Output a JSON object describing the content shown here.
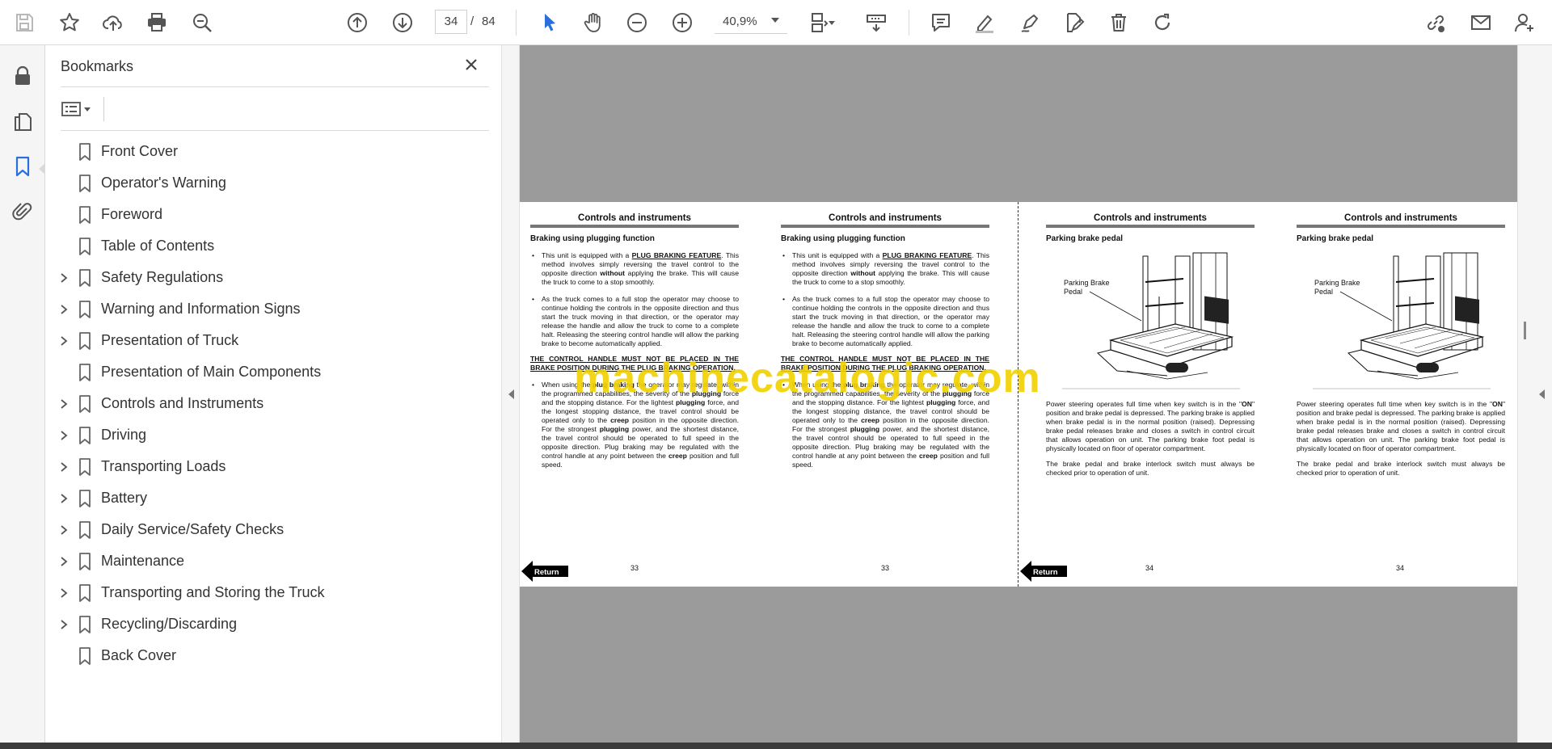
{
  "toolbar": {
    "current_page": "34",
    "page_separator": "/",
    "total_pages": "84",
    "zoom": "40,9%"
  },
  "bookmarks": {
    "title": "Bookmarks",
    "items": [
      {
        "label": "Front Cover",
        "expandable": false
      },
      {
        "label": "Operator's Warning",
        "expandable": false
      },
      {
        "label": "Foreword",
        "expandable": false
      },
      {
        "label": "Table of Contents",
        "expandable": false
      },
      {
        "label": "Safety Regulations",
        "expandable": true
      },
      {
        "label": "Warning and Information Signs",
        "expandable": true
      },
      {
        "label": "Presentation of Truck",
        "expandable": true
      },
      {
        "label": "Presentation of Main Components",
        "expandable": false
      },
      {
        "label": "Controls and Instruments",
        "expandable": true
      },
      {
        "label": "Driving",
        "expandable": true
      },
      {
        "label": "Transporting Loads",
        "expandable": true
      },
      {
        "label": "Battery",
        "expandable": true
      },
      {
        "label": "Daily Service/Safety Checks",
        "expandable": true
      },
      {
        "label": "Maintenance",
        "expandable": true
      },
      {
        "label": "Transporting and Storing the Truck",
        "expandable": true
      },
      {
        "label": "Recycling/Discarding",
        "expandable": true
      },
      {
        "label": "Back Cover",
        "expandable": false
      }
    ]
  },
  "document": {
    "heading": "Controls and instruments",
    "left": {
      "subheading": "Braking using plugging function",
      "b1_a": "This unit is equipped with a ",
      "b1_strong": "PLUG BRAKING FEATURE",
      "b1_b": ". This method involves simply reversing the travel control to the opposite direction ",
      "b1_strong2": "without",
      "b1_c": " applying the brake. This will cause the truck to come to a stop smoothly.",
      "b2": "As the truck comes to a full stop the operator may choose to continue holding the controls in the opposite direction and thus start the truck moving in that direction, or the operator may release the handle and allow the truck to come to a complete halt. Releasing the steering control handle will allow the parking brake to become automatically applied.",
      "warning": "THE CONTROL HANDLE MUST NOT BE PLACED IN THE BRAKE POSITION DURING THE PLUG BRAKING OPERATION.",
      "b3_a": "When using the ",
      "b3_strong": "plug braking",
      "b3_b": " the operator may regulate, within the programmed capabilities, the severity of the ",
      "b3_strong2": "plugging",
      "b3_c": " force and the stopping distance. For the lightest ",
      "b3_strong3": "plugging",
      "b3_d": " force, and the longest stopping distance, the travel control should be operated only to the ",
      "b3_strong4": "creep",
      "b3_e": " position in the opposite direction. For the strongest ",
      "b3_strong5": "plugging",
      "b3_f": " power, and the shortest distance, the travel control should be operated to full speed in the opposite direction. Plug braking may be regulated with the control handle at any point between the ",
      "b3_strong6": "creep",
      "b3_g": " position and full speed.",
      "page_number": "33"
    },
    "right": {
      "subheading": "Parking brake pedal",
      "figure_label": "Parking Brake Pedal",
      "p1_a": "Power steering operates full time when key switch is in the \"",
      "p1_strong": "ON",
      "p1_b": "\" position and brake pedal is depressed. The parking brake is applied when brake pedal is in the normal position (raised). Depressing brake pedal releases brake and closes a switch in control circuit that allows operation on unit. The parking brake foot pedal is physically located on floor of operator compartment.",
      "p2": "The brake pedal and brake interlock switch must always be checked prior to operation of unit.",
      "page_number": "34"
    },
    "return_label": "Return"
  },
  "watermark": "machinecatalogic.com"
}
